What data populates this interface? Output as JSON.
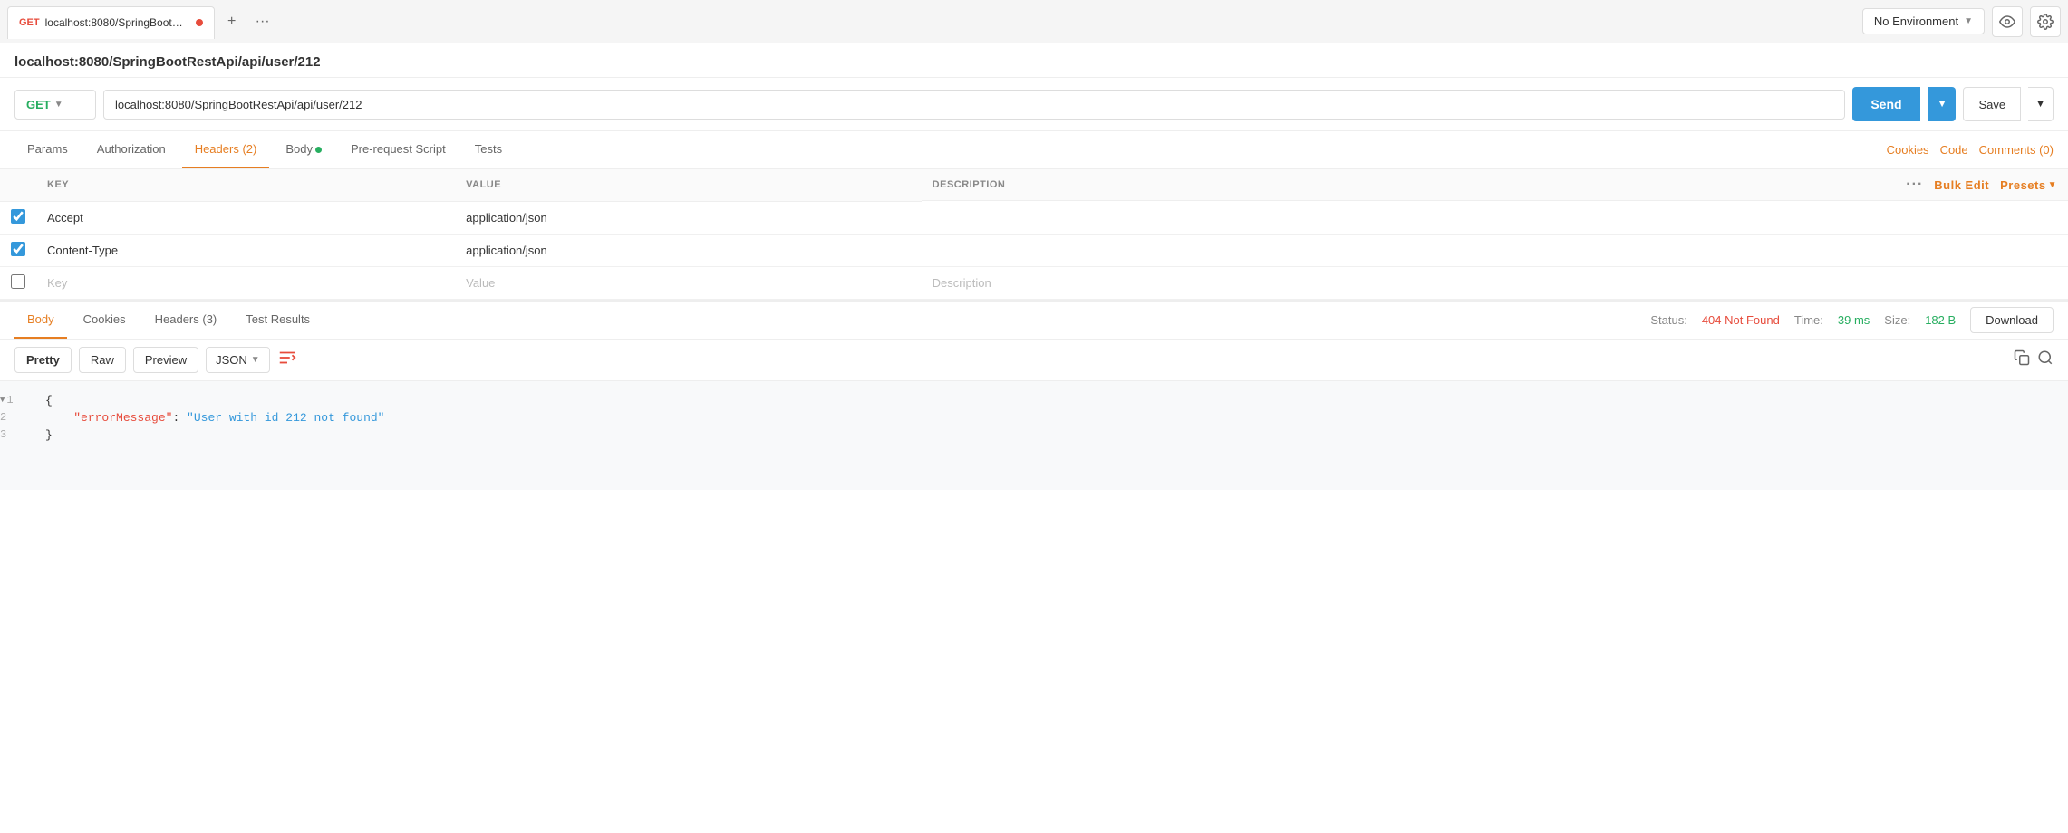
{
  "tab": {
    "method": "GET",
    "url_short": "localhost:8080/SpringBootRestA…",
    "dot_color": "#e74c3c"
  },
  "env": {
    "label": "No Environment"
  },
  "address": {
    "title": "localhost:8080/SpringBootRestApi/api/user/212"
  },
  "request": {
    "method": "GET",
    "url": "localhost:8080/SpringBootRestApi/api/user/212",
    "send_label": "Send",
    "save_label": "Save"
  },
  "req_tabs": [
    {
      "id": "params",
      "label": "Params",
      "active": false
    },
    {
      "id": "authorization",
      "label": "Authorization",
      "active": false
    },
    {
      "id": "headers",
      "label": "Headers",
      "active": true,
      "badge": "(2)"
    },
    {
      "id": "body",
      "label": "Body",
      "active": false,
      "dot": true
    },
    {
      "id": "pre-request",
      "label": "Pre-request Script",
      "active": false
    },
    {
      "id": "tests",
      "label": "Tests",
      "active": false
    }
  ],
  "req_tabs_right": {
    "cookies": "Cookies",
    "code": "Code",
    "comments": "Comments (0)"
  },
  "headers_table": {
    "col_key": "KEY",
    "col_value": "VALUE",
    "col_description": "DESCRIPTION",
    "bulk_edit": "Bulk Edit",
    "presets": "Presets",
    "rows": [
      {
        "checked": true,
        "key": "Accept",
        "value": "application/json",
        "description": ""
      },
      {
        "checked": true,
        "key": "Content-Type",
        "value": "application/json",
        "description": ""
      }
    ],
    "placeholder_row": {
      "key": "Key",
      "value": "Value",
      "description": "Description"
    }
  },
  "resp_tabs": [
    {
      "id": "body",
      "label": "Body",
      "active": true
    },
    {
      "id": "cookies",
      "label": "Cookies",
      "active": false
    },
    {
      "id": "headers",
      "label": "Headers (3)",
      "active": false
    },
    {
      "id": "test-results",
      "label": "Test Results",
      "active": false
    }
  ],
  "resp_status": {
    "status_label": "Status:",
    "status_val": "404 Not Found",
    "time_label": "Time:",
    "time_val": "39 ms",
    "size_label": "Size:",
    "size_val": "182 B",
    "download_label": "Download"
  },
  "resp_toolbar": {
    "pretty": "Pretty",
    "raw": "Raw",
    "preview": "Preview",
    "format": "JSON"
  },
  "code_lines": [
    {
      "num": "1",
      "arrow": true,
      "content": "{"
    },
    {
      "num": "2",
      "arrow": false,
      "key": "\"errorMessage\"",
      "colon": ": ",
      "val": "\"User with id 212 not found\""
    },
    {
      "num": "3",
      "arrow": false,
      "content": "}"
    }
  ]
}
